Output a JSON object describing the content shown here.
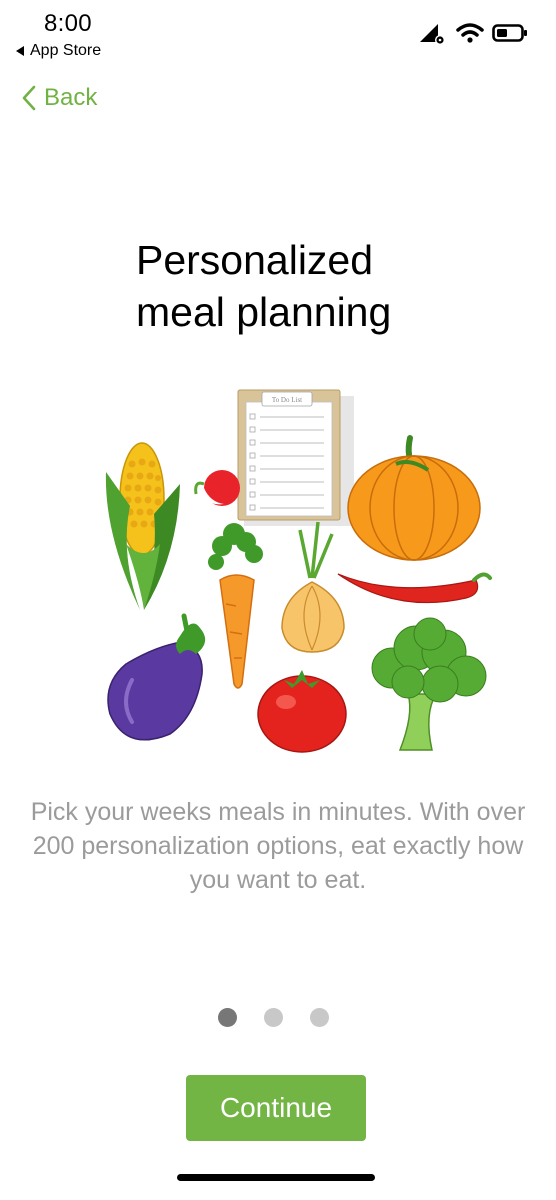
{
  "status_bar": {
    "time": "8:00",
    "back_app": "App Store",
    "icons": [
      "signal-icon",
      "wifi-icon",
      "battery-icon"
    ]
  },
  "nav": {
    "back_label": "Back",
    "accent_color": "#72b245"
  },
  "onboarding": {
    "title_line1": "Personalized",
    "title_line2": "meal planning",
    "illustration": {
      "items": [
        "to-do-list-clipboard",
        "corn",
        "radish",
        "pumpkin",
        "carrot",
        "onion",
        "chili-pepper",
        "eggplant",
        "tomato",
        "broccoli"
      ],
      "clipboard_header": "To Do List"
    },
    "description": "Pick your weeks meals in minutes. With over 200 personalization options, eat exactly how you want to eat.",
    "pager": {
      "total": 3,
      "current": 1
    },
    "continue_label": "Continue",
    "button_color": "#72b545"
  }
}
